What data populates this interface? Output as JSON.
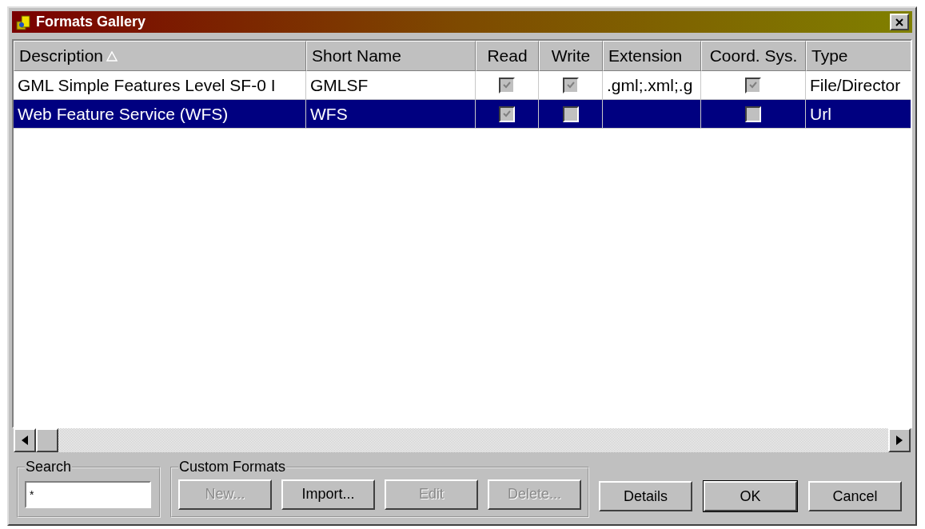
{
  "window": {
    "title": "Formats Gallery"
  },
  "table": {
    "columns": [
      {
        "label": "Description",
        "kind": "text",
        "sorted": true
      },
      {
        "label": "Short Name",
        "kind": "text",
        "sorted": false
      },
      {
        "label": "Read",
        "kind": "check",
        "sorted": false
      },
      {
        "label": "Write",
        "kind": "check",
        "sorted": false
      },
      {
        "label": "Extension",
        "kind": "text",
        "sorted": false
      },
      {
        "label": "Coord. Sys.",
        "kind": "check",
        "sorted": false
      },
      {
        "label": "Type",
        "kind": "text",
        "sorted": false
      }
    ],
    "rows": [
      {
        "selected": false,
        "cells": [
          "GML Simple Features Level SF-0 I",
          "GMLSF",
          {
            "checked": true
          },
          {
            "checked": true
          },
          ".gml;.xml;.g",
          {
            "checked": true
          },
          "File/Director"
        ]
      },
      {
        "selected": true,
        "cells": [
          "Web Feature Service (WFS)",
          "WFS",
          {
            "checked": true
          },
          {
            "checked": false
          },
          "",
          {
            "checked": false
          },
          "Url"
        ]
      }
    ]
  },
  "search": {
    "label": "Search",
    "value": "*"
  },
  "custom_formats": {
    "label": "Custom Formats",
    "buttons": [
      {
        "label": "New...",
        "disabled": true
      },
      {
        "label": "Import...",
        "disabled": false
      },
      {
        "label": "Edit",
        "disabled": true
      },
      {
        "label": "Delete...",
        "disabled": true
      }
    ]
  },
  "buttons": [
    {
      "label": "Details",
      "default": false
    },
    {
      "label": "OK",
      "default": true
    },
    {
      "label": "Cancel",
      "default": false
    }
  ]
}
